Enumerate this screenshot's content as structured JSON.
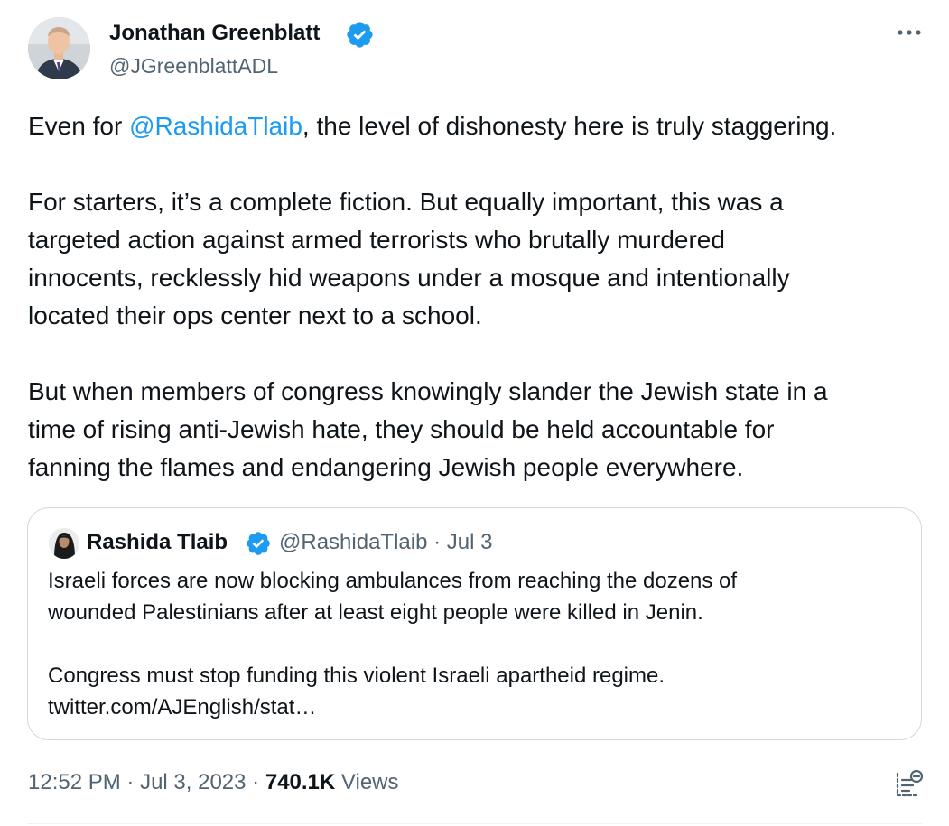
{
  "author": {
    "name": "Jonathan Greenblatt",
    "handle": "@JGreenblattADL"
  },
  "tweet": {
    "p1_prefix": "Even for ",
    "p1_mention": "@RashidaTlaib",
    "p1_suffix": ", the level of dishonesty here is truly staggering.",
    "p2_lines": [
      "For starters, it’s a complete fiction. But equally important, this was a",
      "targeted action against armed terrorists who brutally murdered",
      "innocents, recklessly hid weapons under a mosque and intentionally",
      "located their ops center next to a school."
    ],
    "p3_lines": [
      "But when members of congress knowingly slander the Jewish state in a",
      "time of rising anti-Jewish hate, they should be held accountable for",
      "fanning the flames and endangering Jewish people everywhere."
    ]
  },
  "quote": {
    "name": "Rashida Tlaib",
    "handle": "@RashidaTlaib",
    "separator": "·",
    "date": "Jul 3",
    "p1_lines": [
      "Israeli forces are now blocking ambulances from reaching the dozens of",
      "wounded Palestinians after at least eight people were killed in Jenin."
    ],
    "p2_lines": [
      "Congress must stop funding this violent Israeli apartheid regime.",
      "twitter.com/AJEnglish/stat…"
    ]
  },
  "footer": {
    "time": "12:52 PM",
    "sep1": "·",
    "date": "Jul 3, 2023",
    "sep2": "·",
    "views_count": "740.1K",
    "views_label": "Views"
  },
  "icons": {
    "verified_badge": "verified-badge-icon",
    "more": "more-icon",
    "analytics": "analytics-icon"
  },
  "colors": {
    "verified": "#1d9bf0",
    "mention": "#1d9bf0",
    "secondary_text": "#536471",
    "primary_text": "#0f1419",
    "border": "#cfd9de"
  }
}
